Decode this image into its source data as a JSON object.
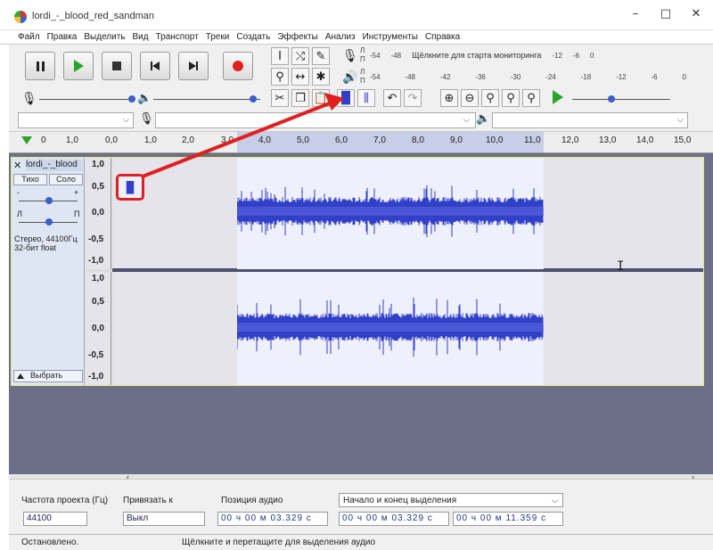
{
  "window": {
    "title": "lordi_-_blood_red_sandman",
    "minimize": "–",
    "maximize": "□",
    "close": "✕"
  },
  "menu": [
    "Файл",
    "Правка",
    "Выделить",
    "Вид",
    "Транспорт",
    "Треки",
    "Создать",
    "Эффекты",
    "Анализ",
    "Инструменты",
    "Справка"
  ],
  "meters": {
    "rec_hint": "Щёлкните для старта мониторинга",
    "rec_ticks": [
      "-54",
      "-48",
      "-12",
      "-6",
      "0"
    ],
    "play_ticks": [
      "-54",
      "-48",
      "-42",
      "-36",
      "-30",
      "-24",
      "-18",
      "-12",
      "-6",
      "0"
    ],
    "L": "Л",
    "R": "П"
  },
  "ruler": {
    "ticks": [
      "0",
      "1,0",
      "0,0",
      "1,0",
      "2,0",
      "3,0",
      "4,0",
      "5,0",
      "6,0",
      "7,0",
      "8,0",
      "9,0",
      "10,0",
      "11,0",
      "12,0",
      "13,0",
      "14,0",
      "15,0"
    ]
  },
  "track": {
    "name": "lordi_-_blood",
    "mute": "Тихо",
    "solo": "Соло",
    "gain_minus": "-",
    "gain_plus": "+",
    "pan_left": "Л",
    "pan_right": "П",
    "info": "Стерео, 44100Гц\n32-бит float",
    "select": "Выбрать",
    "scale_top": [
      "1,0",
      "0,5",
      "0,0",
      "-0,5",
      "-1,0"
    ],
    "scale_bottom": [
      "1,0",
      "0,5",
      "0,0",
      "-0,5",
      "-1,0"
    ]
  },
  "bottom": {
    "rate_label": "Частота проекта (Гц)",
    "rate_value": "44100",
    "snap_label": "Привязать к",
    "snap_value": "Выкл",
    "pos_label": "Позиция аудио",
    "pos_value": "00 ч 00 м 03.329 с",
    "sel_label": "Начало и конец выделения",
    "sel_start": "00 ч 00 м 03.329 с",
    "sel_end": "00 ч 00 м 11.359 с"
  },
  "status": {
    "left": "Остановлено.",
    "right": "Щёлкните и перетащите для выделения аудио"
  },
  "colors": {
    "wave": "#3240c8",
    "selection": "#eef0fb",
    "arrow": "#e02020",
    "track_border": "#e3e97a"
  }
}
